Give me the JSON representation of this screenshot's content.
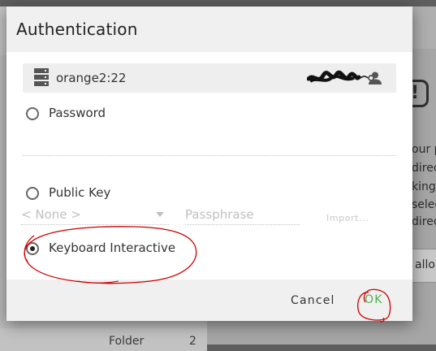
{
  "background": {
    "folder_label": "Folder",
    "folder_count": "2",
    "warning_glyph": "!",
    "text_lines": [
      "our p",
      "direc",
      "king",
      "selec",
      "direc"
    ],
    "button_label": "allo"
  },
  "dialog": {
    "title": "Authentication",
    "host": {
      "label": "orange2:22",
      "icon": "server-icon",
      "user_icon": "user-icon"
    },
    "options": [
      {
        "label": "Password",
        "checked": false
      },
      {
        "label": "Public Key",
        "checked": false
      },
      {
        "label": "Keyboard Interactive",
        "checked": true
      }
    ],
    "public_key": {
      "key_select_value": "< None >",
      "passphrase_placeholder": "Passphrase",
      "import_label": "Import..."
    },
    "buttons": {
      "cancel": "Cancel",
      "ok": "OK"
    }
  },
  "colors": {
    "ok_accent": "#4caf50",
    "annotation": "#cc0000",
    "overlay": "#5e5e5e"
  }
}
